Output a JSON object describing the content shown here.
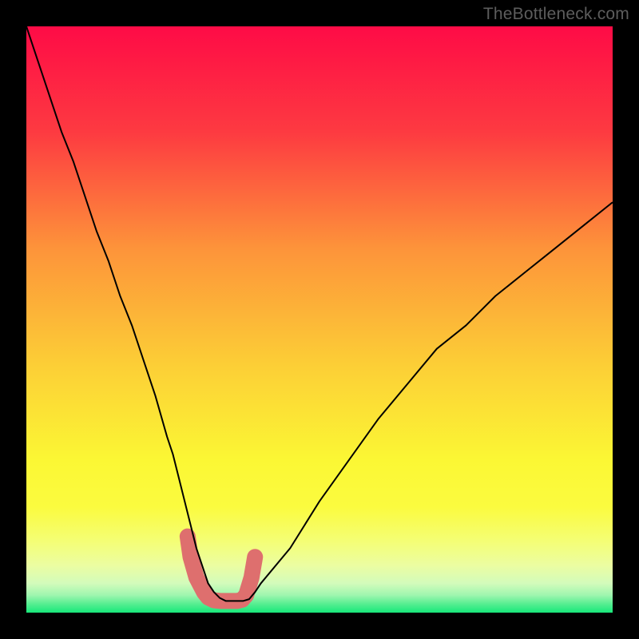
{
  "watermark": "TheBottleneck.com",
  "chart_data": {
    "type": "line",
    "title": "",
    "xlabel": "",
    "ylabel": "",
    "xlim": [
      0,
      100
    ],
    "ylim": [
      0,
      100
    ],
    "grid": false,
    "legend": false,
    "background_gradient": {
      "top": "#fe0b46",
      "mid_upper": "#fd943a",
      "mid": "#fbf734",
      "mid_lower": "#f4fe77",
      "bottom": "#17e87a"
    },
    "series": [
      {
        "name": "bottleneck-curve",
        "color": "#000000",
        "stroke_width": 2,
        "x": [
          0,
          1,
          2,
          4,
          6,
          8,
          10,
          12,
          14,
          16,
          18,
          20,
          22,
          24,
          25,
          26,
          27,
          28,
          29,
          30,
          31,
          32,
          33,
          34,
          35,
          36,
          37,
          38,
          39,
          40,
          45,
          50,
          55,
          60,
          65,
          70,
          75,
          80,
          85,
          90,
          95,
          100
        ],
        "y": [
          100,
          97,
          94,
          88,
          82,
          77,
          71,
          65,
          60,
          54,
          49,
          43,
          37,
          30,
          27,
          23,
          19,
          15,
          11,
          8,
          5,
          3.5,
          2.5,
          2.0,
          2.0,
          2.0,
          2.0,
          2.3,
          3.5,
          5.0,
          11,
          19,
          26,
          33,
          39,
          45,
          49,
          54,
          58,
          62,
          66,
          70
        ]
      },
      {
        "name": "highlight-band",
        "color": "#de6f6e",
        "stroke_width": 20,
        "linecap": "round",
        "x": [
          27.5,
          28.0,
          29.0,
          30.3,
          31.0,
          32.0,
          33.0,
          34.0,
          35.0,
          36.0,
          36.8,
          37.5,
          38.4,
          39.0
        ],
        "y": [
          13.0,
          9.5,
          6.0,
          3.5,
          2.6,
          2.1,
          2.0,
          2.0,
          2.0,
          2.0,
          2.2,
          3.0,
          6.0,
          9.5
        ]
      }
    ]
  }
}
